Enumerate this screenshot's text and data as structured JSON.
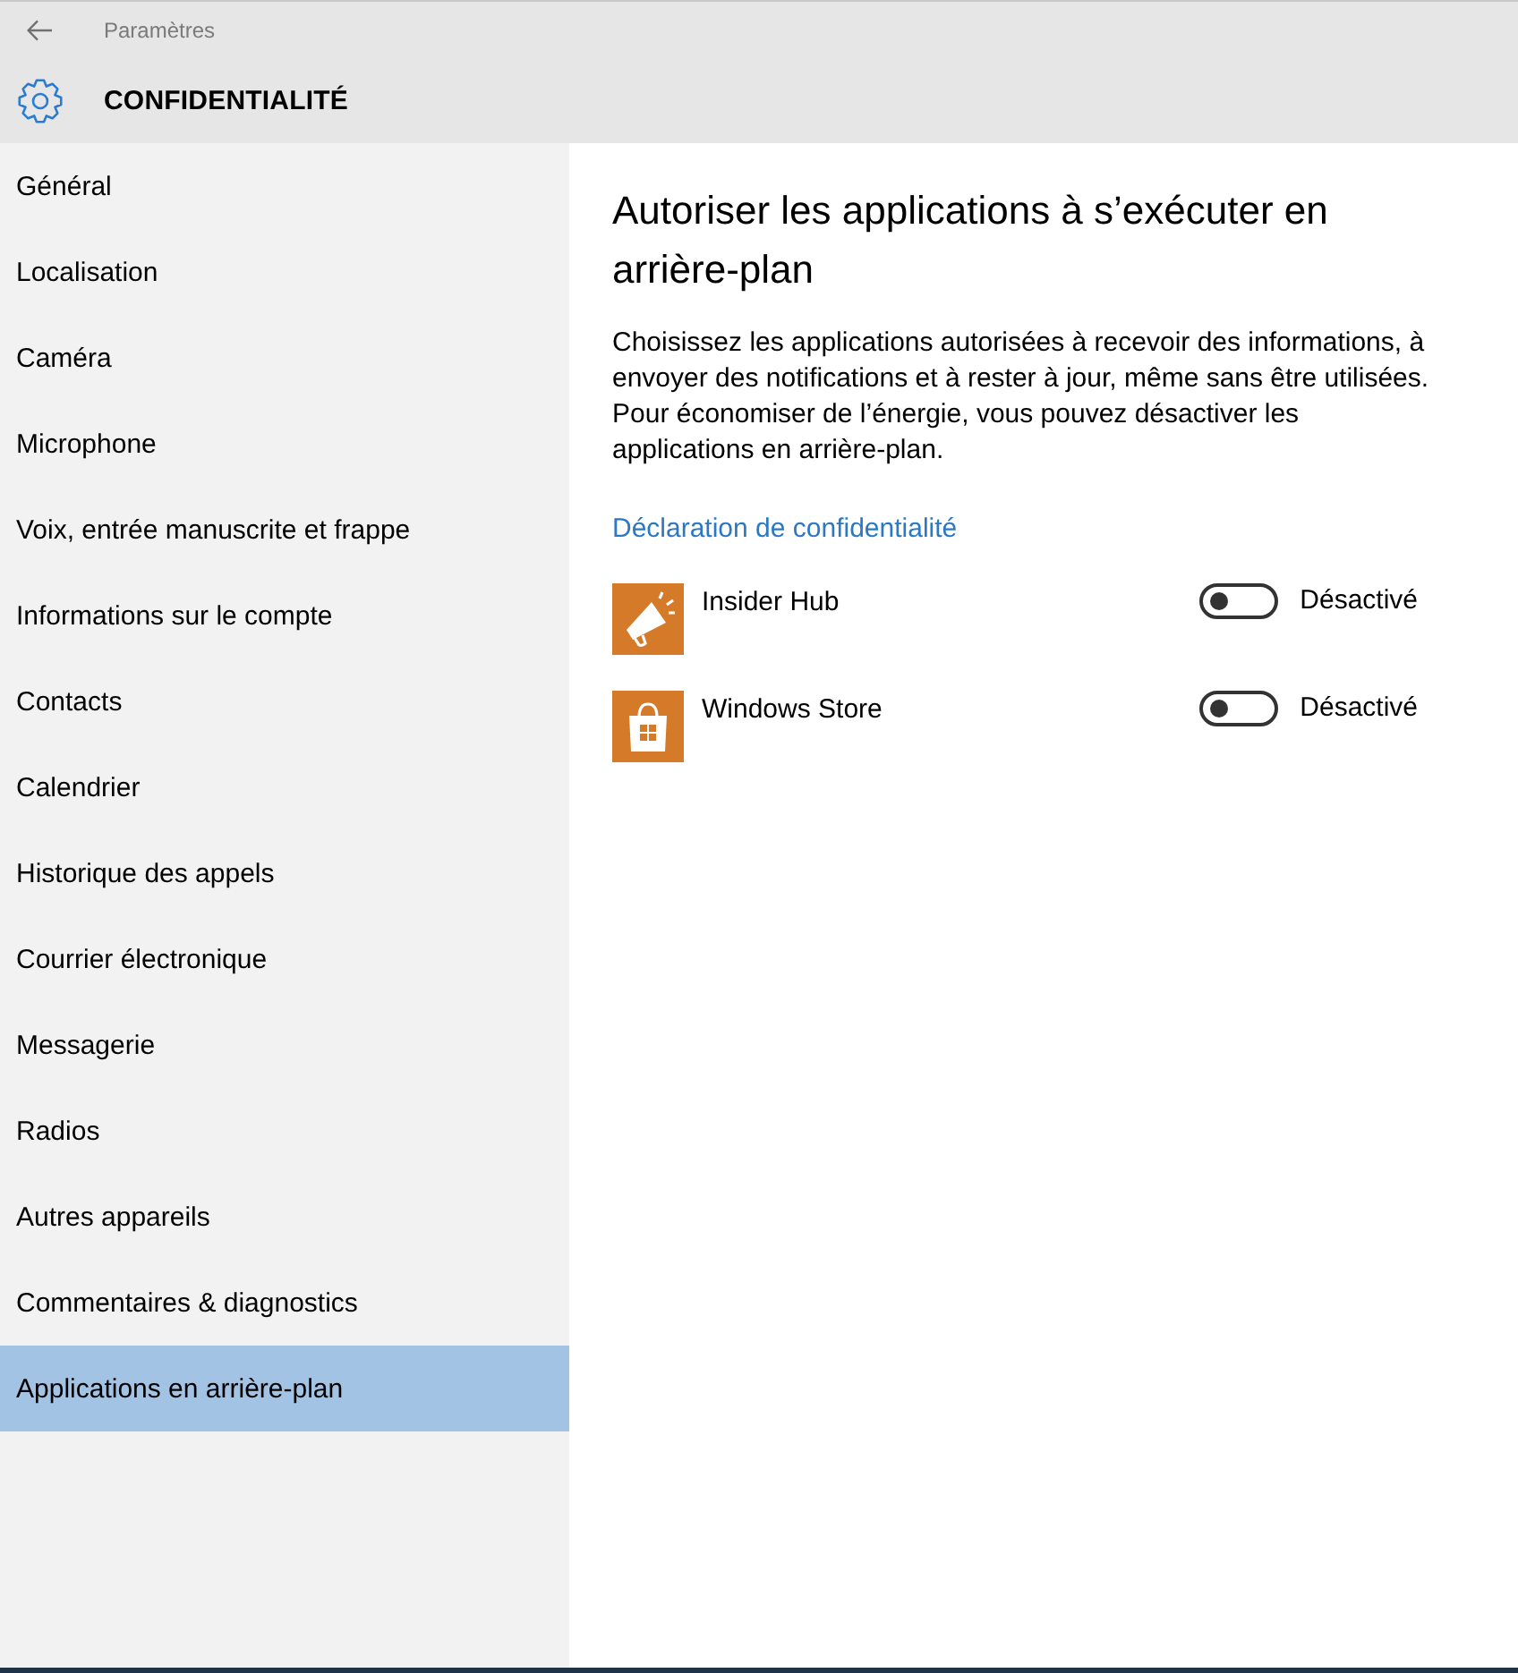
{
  "window": {
    "app_title": "Paramètres",
    "section_title": "CONFIDENTIALITÉ"
  },
  "sidebar": {
    "items": [
      {
        "label": "Général",
        "selected": false
      },
      {
        "label": "Localisation",
        "selected": false
      },
      {
        "label": "Caméra",
        "selected": false
      },
      {
        "label": "Microphone",
        "selected": false
      },
      {
        "label": "Voix, entrée manuscrite et frappe",
        "selected": false
      },
      {
        "label": "Informations sur le compte",
        "selected": false
      },
      {
        "label": "Contacts",
        "selected": false
      },
      {
        "label": "Calendrier",
        "selected": false
      },
      {
        "label": "Historique des appels",
        "selected": false
      },
      {
        "label": "Courrier électronique",
        "selected": false
      },
      {
        "label": "Messagerie",
        "selected": false
      },
      {
        "label": "Radios",
        "selected": false
      },
      {
        "label": "Autres appareils",
        "selected": false
      },
      {
        "label": "Commentaires & diagnostics",
        "selected": false
      },
      {
        "label": "Applications en arrière-plan",
        "selected": true
      }
    ]
  },
  "content": {
    "title": "Autoriser les applications à s’exécuter en arrière-plan",
    "description": "Choisissez les applications autorisées à recevoir des informations, à envoyer des notifications et à rester à jour, même sans être utilisées. Pour économiser de l’énergie, vous pouvez désactiver les applications en arrière-plan.",
    "privacy_link": "Déclaration de confidentialité",
    "apps": [
      {
        "kind": "megaphone",
        "name": "Insider Hub",
        "on": false,
        "state_label": "Désactivé"
      },
      {
        "kind": "store",
        "name": "Windows Store",
        "on": false,
        "state_label": "Désactivé"
      }
    ]
  }
}
